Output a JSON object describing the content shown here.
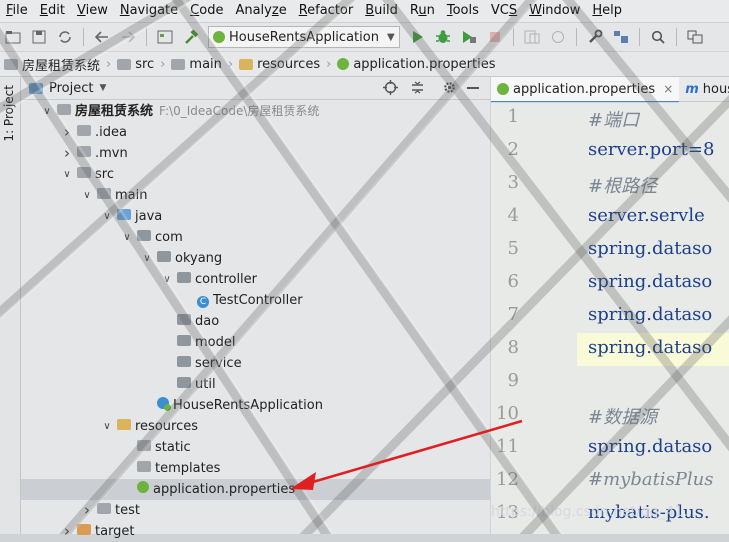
{
  "menu": [
    "File",
    "Edit",
    "View",
    "Navigate",
    "Code",
    "Analyze",
    "Refactor",
    "Build",
    "Run",
    "Tools",
    "VCS",
    "Window",
    "Help"
  ],
  "menu_mnemonics": [
    "F",
    "E",
    "V",
    "N",
    "C",
    "z",
    "R",
    "B",
    "u",
    "T",
    "S",
    "W",
    "H"
  ],
  "toolbar": {
    "run_config": "HouseRentsApplication"
  },
  "breadcrumb": [
    "房屋租赁系统",
    "src",
    "main",
    "resources",
    "application.properties"
  ],
  "side_strip": {
    "label": "1: Project"
  },
  "project_panel": {
    "title": "Project",
    "tree": [
      {
        "label": "房屋租赁系统",
        "hint": "F:\\0_IdeaCode\\房屋租赁系统",
        "icon": "folder-icon",
        "arrow": "expanded"
      },
      {
        "label": ".idea",
        "icon": "folder-icon",
        "arrow": "collapsed"
      },
      {
        "label": ".mvn",
        "icon": "folder-icon",
        "arrow": "collapsed"
      },
      {
        "label": "src",
        "icon": "folder-icon",
        "arrow": "expanded"
      },
      {
        "label": "main",
        "icon": "folder-icon",
        "arrow": "expanded"
      },
      {
        "label": "java",
        "icon": "source-folder-icon",
        "arrow": "expanded"
      },
      {
        "label": "com",
        "icon": "package-icon",
        "arrow": "expanded"
      },
      {
        "label": "okyang",
        "icon": "package-icon",
        "arrow": "expanded"
      },
      {
        "label": "controller",
        "icon": "package-icon",
        "arrow": "expanded"
      },
      {
        "label": "TestController",
        "icon": "class-icon",
        "arrow": "none"
      },
      {
        "label": "dao",
        "icon": "package-icon",
        "arrow": "none"
      },
      {
        "label": "model",
        "icon": "package-icon",
        "arrow": "none"
      },
      {
        "label": "service",
        "icon": "package-icon",
        "arrow": "none"
      },
      {
        "label": "util",
        "icon": "package-icon",
        "arrow": "none"
      },
      {
        "label": "HouseRentsApplication",
        "icon": "spring-class-icon",
        "arrow": "none"
      },
      {
        "label": "resources",
        "icon": "resources-folder-icon",
        "arrow": "expanded"
      },
      {
        "label": "static",
        "icon": "folder-icon",
        "arrow": "none"
      },
      {
        "label": "templates",
        "icon": "folder-icon",
        "arrow": "none"
      },
      {
        "label": "application.properties",
        "icon": "spring-properties-icon",
        "arrow": "none",
        "selected": true
      },
      {
        "label": "test",
        "icon": "folder-icon",
        "arrow": "collapsed"
      },
      {
        "label": "target",
        "icon": "excluded-folder-icon",
        "arrow": "collapsed"
      }
    ]
  },
  "editor": {
    "tabs": [
      {
        "label": "application.properties",
        "active": true,
        "closable": true
      },
      {
        "label": "house_",
        "active": false
      }
    ],
    "lines": [
      {
        "no": "1",
        "parts": [
          {
            "cls": "c-comment",
            "text": "#端口"
          }
        ]
      },
      {
        "no": "2",
        "parts": [
          {
            "cls": "c-key",
            "text": "server.port="
          },
          {
            "cls": "c-key",
            "text": "8"
          }
        ]
      },
      {
        "no": "3",
        "parts": [
          {
            "cls": "c-comment",
            "text": "#根路径"
          }
        ]
      },
      {
        "no": "4",
        "parts": [
          {
            "cls": "c-key",
            "text": "server.servle"
          }
        ]
      },
      {
        "no": "5",
        "parts": [
          {
            "cls": "c-key",
            "text": "spring.dataso"
          }
        ]
      },
      {
        "no": "6",
        "parts": [
          {
            "cls": "c-key",
            "text": "spring.dataso"
          }
        ]
      },
      {
        "no": "7",
        "parts": [
          {
            "cls": "c-key",
            "text": "spring.dataso"
          }
        ]
      },
      {
        "no": "8",
        "parts": [
          {
            "cls": "c-key",
            "text": "spring.dataso"
          }
        ]
      },
      {
        "no": "9",
        "parts": []
      },
      {
        "no": "10",
        "parts": [
          {
            "cls": "c-comment",
            "text": "#数据源"
          }
        ]
      },
      {
        "no": "11",
        "parts": [
          {
            "cls": "c-key",
            "text": "spring.dataso"
          }
        ]
      },
      {
        "no": "12",
        "parts": [
          {
            "cls": "c-comment",
            "text": "#mybatisPlus"
          }
        ]
      },
      {
        "no": "13",
        "parts": [
          {
            "cls": "c-key",
            "text": "mybatis-plus."
          }
        ]
      }
    ],
    "highlighted_line": "8",
    "watermark": "https://blog.csdn.net/qq_41..."
  },
  "colors": {
    "accent": "#4a86c8",
    "spring": "#6db33f",
    "arrow": "#e02020"
  }
}
